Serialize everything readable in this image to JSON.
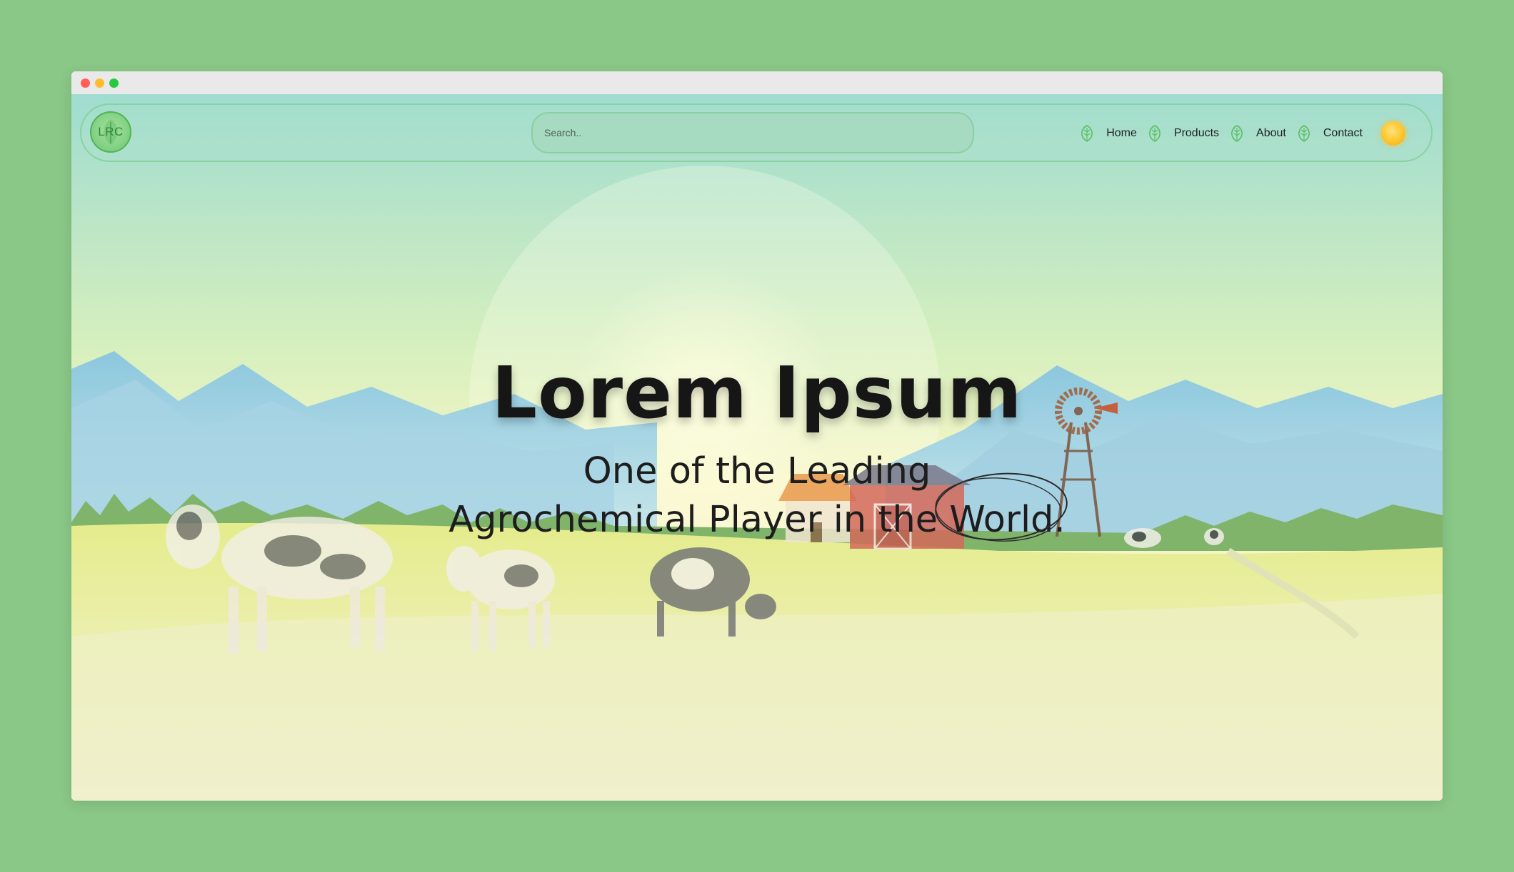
{
  "brand": {
    "logo_text": "LRC"
  },
  "search": {
    "placeholder": "Search.."
  },
  "nav": {
    "items": [
      {
        "label": "Home",
        "icon": "leaf-icon"
      },
      {
        "label": "Products",
        "icon": "leaf-icon"
      },
      {
        "label": "About",
        "icon": "leaf-icon"
      },
      {
        "label": "Contact",
        "icon": "leaf-icon"
      }
    ],
    "theme_toggle_icon": "sun-icon"
  },
  "hero": {
    "title": "Lorem Ipsum",
    "subtitle_line1": "One of the Leading",
    "subtitle_line2": "Agrochemical Player in the World."
  },
  "colors": {
    "page_background": "#8ac887",
    "accent_green": "#4fb455",
    "sun": "#ffc52a"
  }
}
